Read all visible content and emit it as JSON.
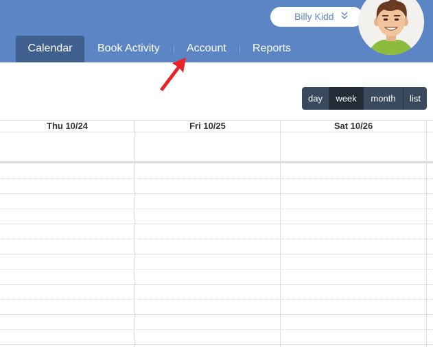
{
  "user": {
    "name": "Billy Kidd",
    "chevron_icon": "chevron-double-down-icon"
  },
  "nav": {
    "tabs": [
      {
        "label": "Calendar",
        "active": true
      },
      {
        "label": "Book Activity",
        "active": false
      },
      {
        "label": "Account",
        "active": false
      },
      {
        "label": "Reports",
        "active": false
      }
    ]
  },
  "view_buttons": [
    {
      "label": "day",
      "active": false
    },
    {
      "label": "week",
      "active": true
    },
    {
      "label": "month",
      "active": false
    },
    {
      "label": "list",
      "active": false
    }
  ],
  "calendar": {
    "day_headers": [
      "Thu 10/24",
      "Fri 10/25",
      "Sat 10/26"
    ]
  },
  "colors": {
    "header": "#5b85c4",
    "active_tab": "#3f5f8e",
    "view_group": "#3a4a5e",
    "view_active": "#222c36",
    "annotation_arrow": "#e8242a"
  }
}
